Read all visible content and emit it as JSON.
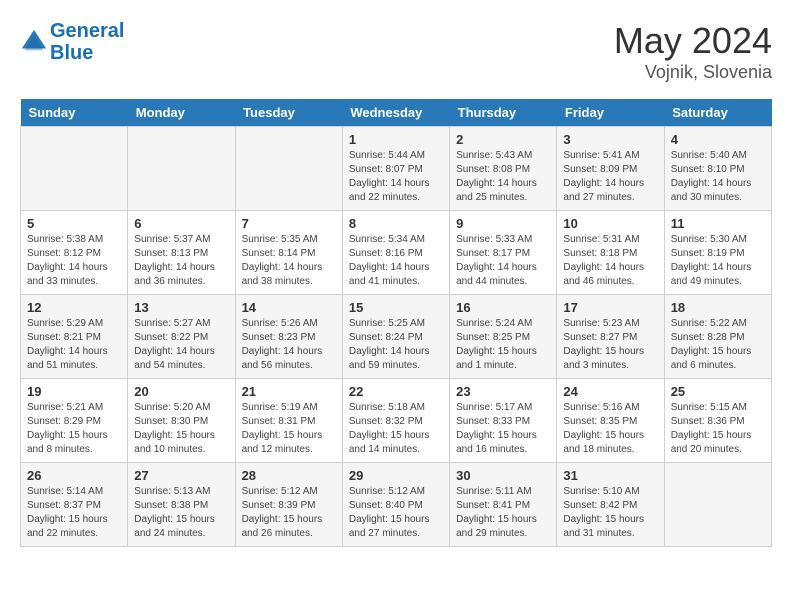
{
  "header": {
    "logo_line1": "General",
    "logo_line2": "Blue",
    "month_year": "May 2024",
    "location": "Vojnik, Slovenia"
  },
  "weekdays": [
    "Sunday",
    "Monday",
    "Tuesday",
    "Wednesday",
    "Thursday",
    "Friday",
    "Saturday"
  ],
  "weeks": [
    [
      {
        "day": "",
        "info": ""
      },
      {
        "day": "",
        "info": ""
      },
      {
        "day": "",
        "info": ""
      },
      {
        "day": "1",
        "info": "Sunrise: 5:44 AM\nSunset: 8:07 PM\nDaylight: 14 hours\nand 22 minutes."
      },
      {
        "day": "2",
        "info": "Sunrise: 5:43 AM\nSunset: 8:08 PM\nDaylight: 14 hours\nand 25 minutes."
      },
      {
        "day": "3",
        "info": "Sunrise: 5:41 AM\nSunset: 8:09 PM\nDaylight: 14 hours\nand 27 minutes."
      },
      {
        "day": "4",
        "info": "Sunrise: 5:40 AM\nSunset: 8:10 PM\nDaylight: 14 hours\nand 30 minutes."
      }
    ],
    [
      {
        "day": "5",
        "info": "Sunrise: 5:38 AM\nSunset: 8:12 PM\nDaylight: 14 hours\nand 33 minutes."
      },
      {
        "day": "6",
        "info": "Sunrise: 5:37 AM\nSunset: 8:13 PM\nDaylight: 14 hours\nand 36 minutes."
      },
      {
        "day": "7",
        "info": "Sunrise: 5:35 AM\nSunset: 8:14 PM\nDaylight: 14 hours\nand 38 minutes."
      },
      {
        "day": "8",
        "info": "Sunrise: 5:34 AM\nSunset: 8:16 PM\nDaylight: 14 hours\nand 41 minutes."
      },
      {
        "day": "9",
        "info": "Sunrise: 5:33 AM\nSunset: 8:17 PM\nDaylight: 14 hours\nand 44 minutes."
      },
      {
        "day": "10",
        "info": "Sunrise: 5:31 AM\nSunset: 8:18 PM\nDaylight: 14 hours\nand 46 minutes."
      },
      {
        "day": "11",
        "info": "Sunrise: 5:30 AM\nSunset: 8:19 PM\nDaylight: 14 hours\nand 49 minutes."
      }
    ],
    [
      {
        "day": "12",
        "info": "Sunrise: 5:29 AM\nSunset: 8:21 PM\nDaylight: 14 hours\nand 51 minutes."
      },
      {
        "day": "13",
        "info": "Sunrise: 5:27 AM\nSunset: 8:22 PM\nDaylight: 14 hours\nand 54 minutes."
      },
      {
        "day": "14",
        "info": "Sunrise: 5:26 AM\nSunset: 8:23 PM\nDaylight: 14 hours\nand 56 minutes."
      },
      {
        "day": "15",
        "info": "Sunrise: 5:25 AM\nSunset: 8:24 PM\nDaylight: 14 hours\nand 59 minutes."
      },
      {
        "day": "16",
        "info": "Sunrise: 5:24 AM\nSunset: 8:25 PM\nDaylight: 15 hours\nand 1 minute."
      },
      {
        "day": "17",
        "info": "Sunrise: 5:23 AM\nSunset: 8:27 PM\nDaylight: 15 hours\nand 3 minutes."
      },
      {
        "day": "18",
        "info": "Sunrise: 5:22 AM\nSunset: 8:28 PM\nDaylight: 15 hours\nand 6 minutes."
      }
    ],
    [
      {
        "day": "19",
        "info": "Sunrise: 5:21 AM\nSunset: 8:29 PM\nDaylight: 15 hours\nand 8 minutes."
      },
      {
        "day": "20",
        "info": "Sunrise: 5:20 AM\nSunset: 8:30 PM\nDaylight: 15 hours\nand 10 minutes."
      },
      {
        "day": "21",
        "info": "Sunrise: 5:19 AM\nSunset: 8:31 PM\nDaylight: 15 hours\nand 12 minutes."
      },
      {
        "day": "22",
        "info": "Sunrise: 5:18 AM\nSunset: 8:32 PM\nDaylight: 15 hours\nand 14 minutes."
      },
      {
        "day": "23",
        "info": "Sunrise: 5:17 AM\nSunset: 8:33 PM\nDaylight: 15 hours\nand 16 minutes."
      },
      {
        "day": "24",
        "info": "Sunrise: 5:16 AM\nSunset: 8:35 PM\nDaylight: 15 hours\nand 18 minutes."
      },
      {
        "day": "25",
        "info": "Sunrise: 5:15 AM\nSunset: 8:36 PM\nDaylight: 15 hours\nand 20 minutes."
      }
    ],
    [
      {
        "day": "26",
        "info": "Sunrise: 5:14 AM\nSunset: 8:37 PM\nDaylight: 15 hours\nand 22 minutes."
      },
      {
        "day": "27",
        "info": "Sunrise: 5:13 AM\nSunset: 8:38 PM\nDaylight: 15 hours\nand 24 minutes."
      },
      {
        "day": "28",
        "info": "Sunrise: 5:12 AM\nSunset: 8:39 PM\nDaylight: 15 hours\nand 26 minutes."
      },
      {
        "day": "29",
        "info": "Sunrise: 5:12 AM\nSunset: 8:40 PM\nDaylight: 15 hours\nand 27 minutes."
      },
      {
        "day": "30",
        "info": "Sunrise: 5:11 AM\nSunset: 8:41 PM\nDaylight: 15 hours\nand 29 minutes."
      },
      {
        "day": "31",
        "info": "Sunrise: 5:10 AM\nSunset: 8:42 PM\nDaylight: 15 hours\nand 31 minutes."
      },
      {
        "day": "",
        "info": ""
      }
    ]
  ]
}
